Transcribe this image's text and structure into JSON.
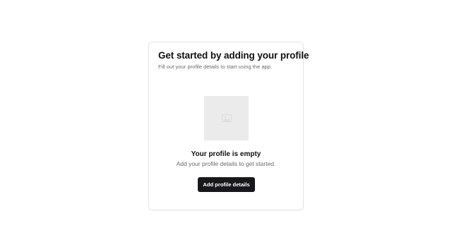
{
  "card": {
    "title": "Get started by adding your profile",
    "subtitle": "Fill out your profile details to start using the app."
  },
  "empty_state": {
    "image_icon": "image-placeholder-icon",
    "heading": "Your profile is empty",
    "description": "Add your profile details to get started.",
    "button_label": "Add profile details"
  },
  "colors": {
    "button_background": "#18181b",
    "placeholder_background": "#ebebeb",
    "muted_text": "#6b6b70"
  }
}
